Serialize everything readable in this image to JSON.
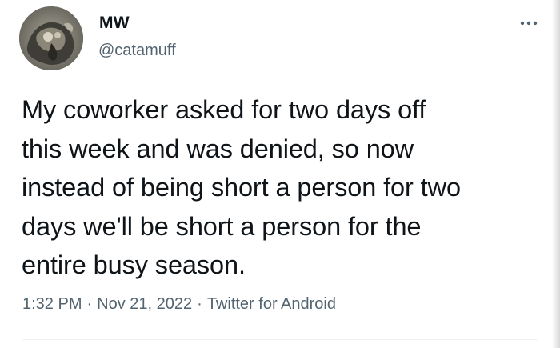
{
  "author": {
    "display_name": "MW",
    "handle": "@catamuff",
    "avatar_icon": "user-avatar"
  },
  "tweet": {
    "lines": [
      "My coworker asked for two days off",
      "this week and was denied, so now",
      "instead of being short a person for two",
      "days we'll be short a person for the",
      "entire busy season."
    ]
  },
  "meta": {
    "time": "1:32 PM",
    "separator": "·",
    "date": "Nov 21, 2022",
    "source": "Twitter for Android"
  },
  "icons": {
    "more": "more-options-icon"
  },
  "colors": {
    "text": "#0f1419",
    "secondary": "#536471"
  }
}
